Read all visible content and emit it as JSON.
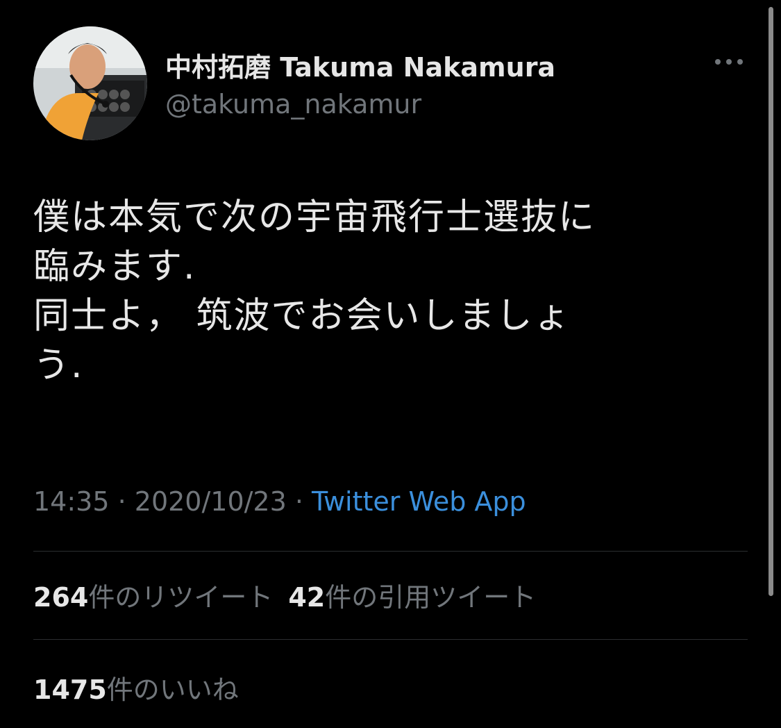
{
  "author": {
    "display_name": "中村拓磨 Takuma Nakamura",
    "handle": "@takuma_nakamur",
    "avatar_icon": "pilot-photo"
  },
  "more_icon": "ellipsis-icon",
  "tweet": {
    "text": "僕は本気で次の宇宙飛行士選抜に\n臨みます.\n同士よ， 筑波でお会いしましょ\nう."
  },
  "meta": {
    "time": "14:35",
    "separator": " · ",
    "date": "2020/10/23",
    "source": "Twitter Web App"
  },
  "stats": {
    "retweets_count": "264",
    "retweets_label": "件のリツイート",
    "quotes_count": "42",
    "quotes_label": "件の引用ツイート",
    "likes_count": "1475",
    "likes_label": "件のいいね"
  },
  "colors": {
    "background": "#000000",
    "link": "#3b8fdc",
    "secondary_text": "#71767b"
  }
}
